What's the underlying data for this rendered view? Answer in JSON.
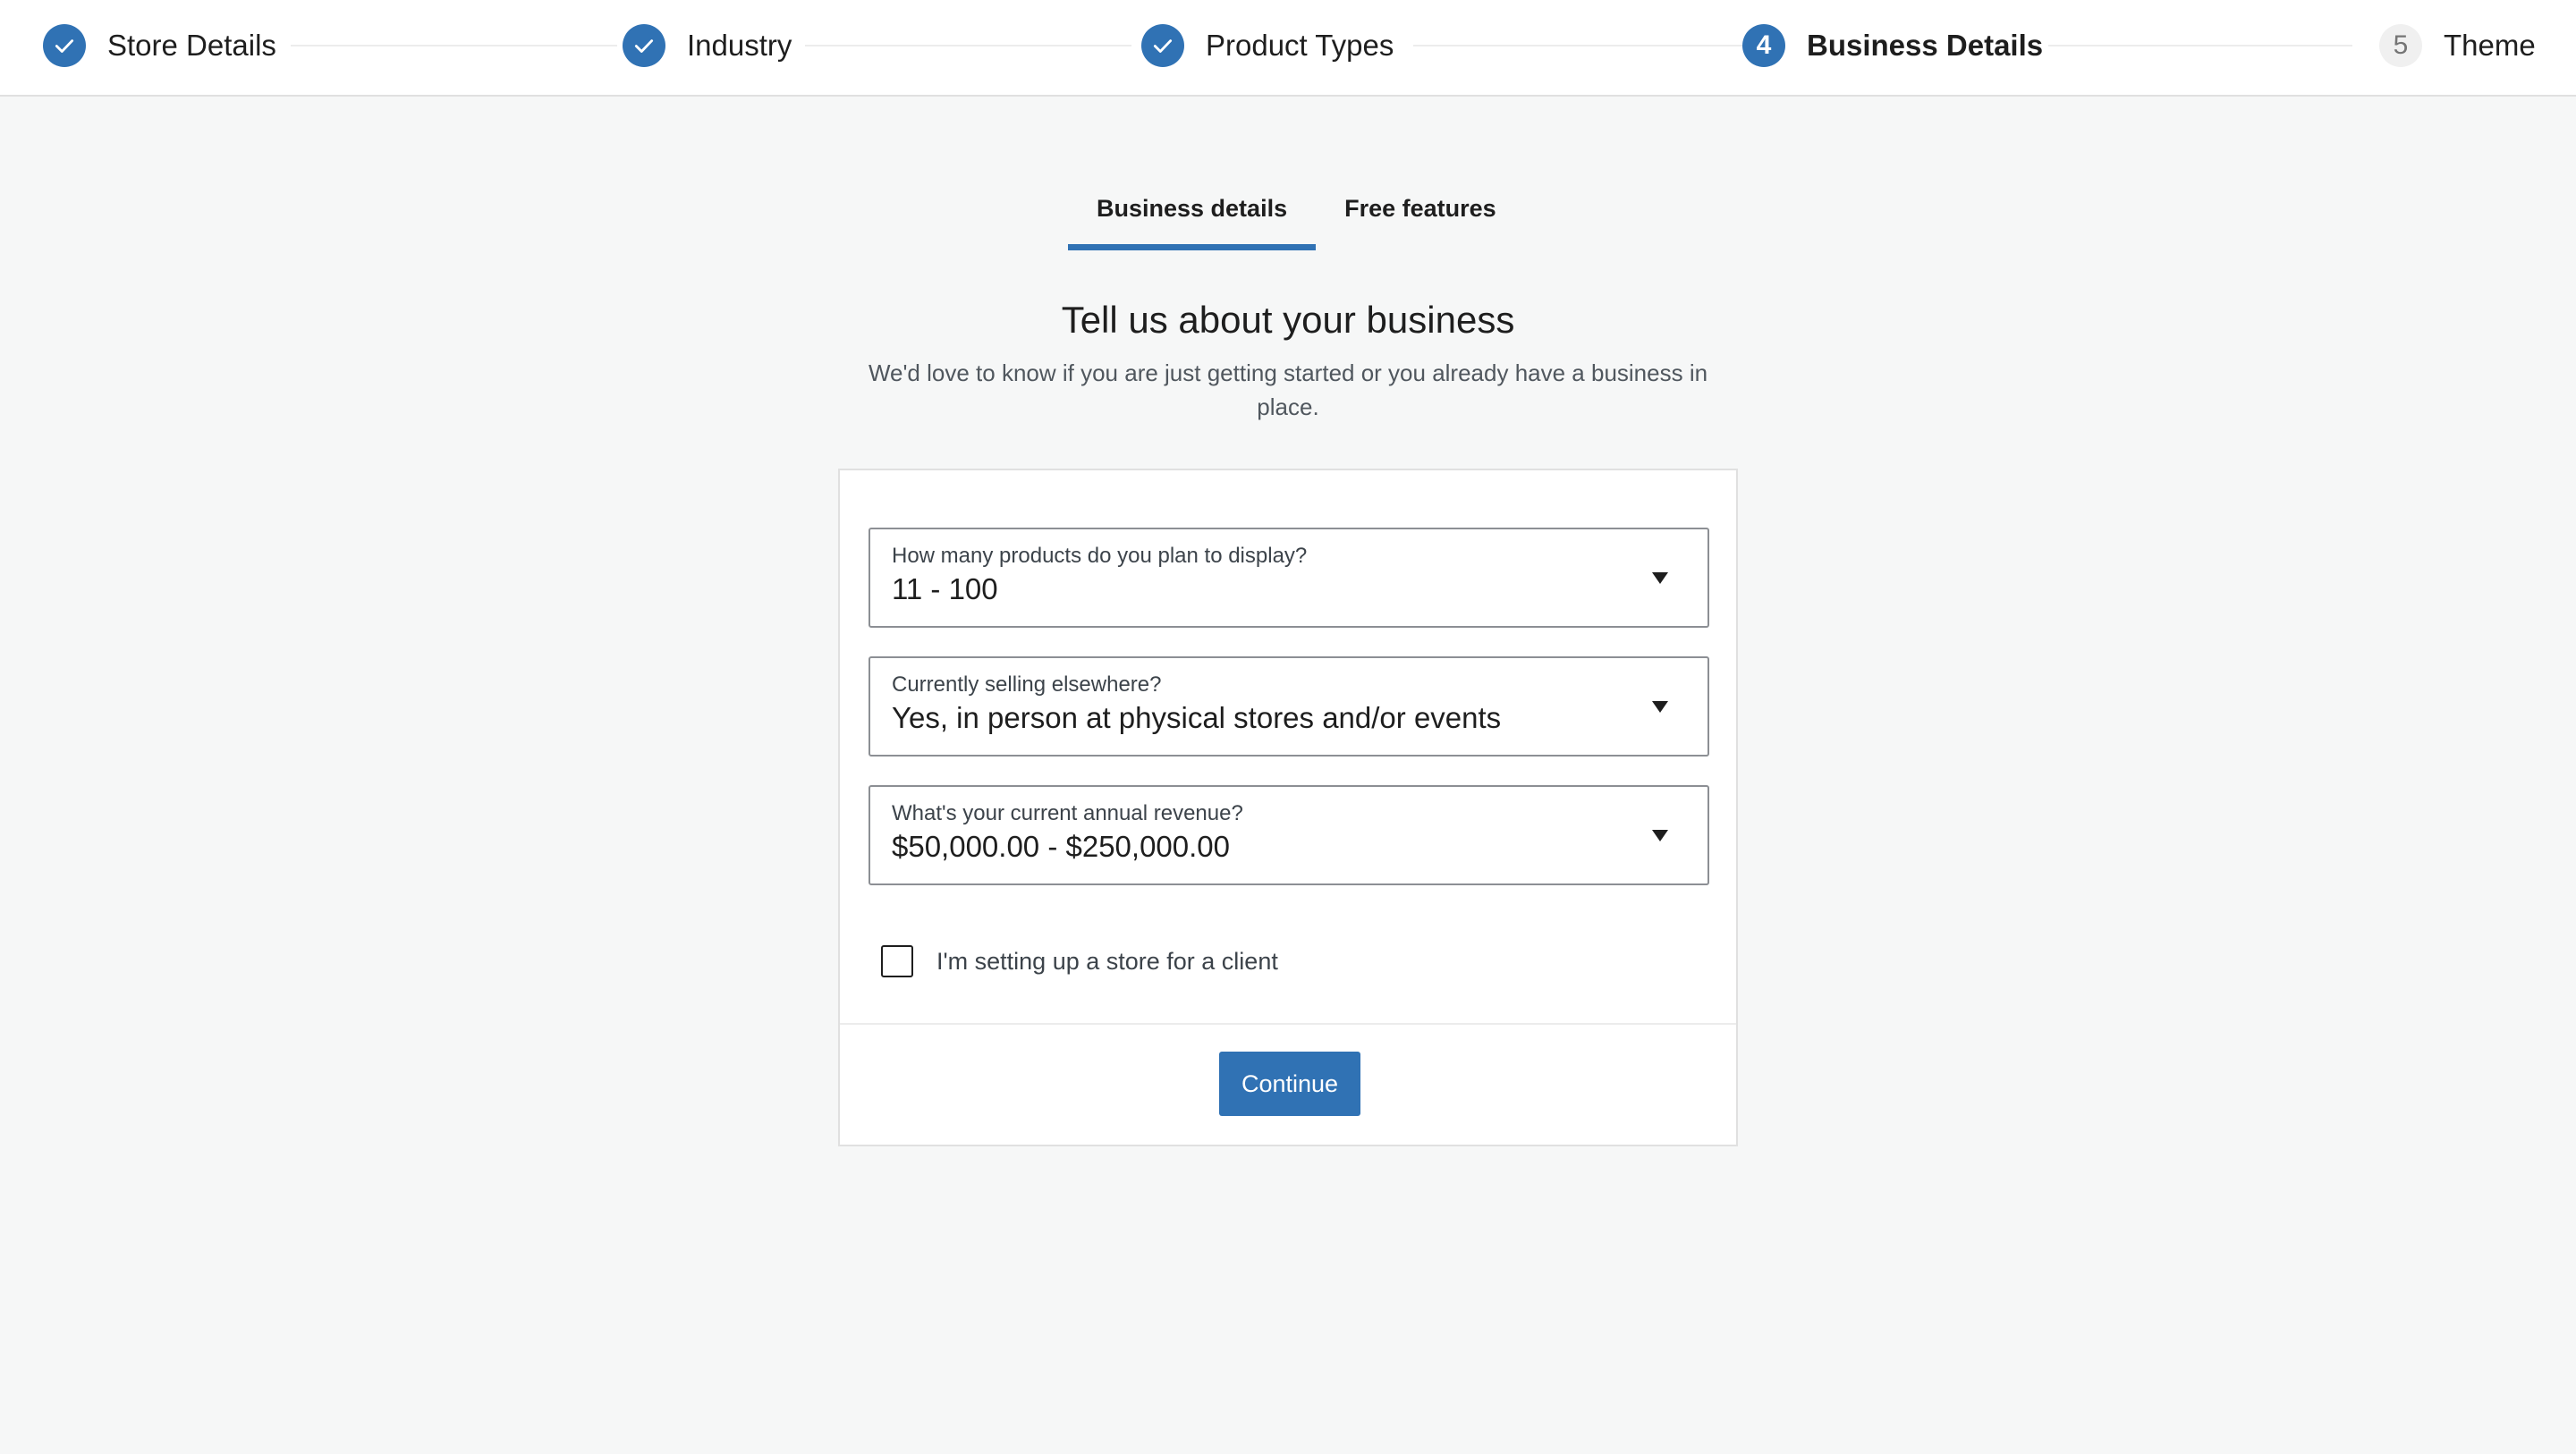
{
  "colors": {
    "accent": "#3072b4",
    "page_background": "#f6f7f7",
    "card_background": "#ffffff"
  },
  "stepper": {
    "steps": [
      {
        "label": "Store Details",
        "status": "complete",
        "icon": "checkmark-icon"
      },
      {
        "label": "Industry",
        "status": "complete",
        "icon": "checkmark-icon"
      },
      {
        "label": "Product Types",
        "status": "complete",
        "icon": "checkmark-icon"
      },
      {
        "label": "Business Details",
        "status": "current",
        "number": "4"
      },
      {
        "label": "Theme",
        "status": "upcoming",
        "number": "5"
      }
    ]
  },
  "tabs": [
    {
      "label": "Business details",
      "active": true
    },
    {
      "label": "Free features",
      "active": false
    }
  ],
  "heading": {
    "title": "Tell us about your business",
    "subtitle": "We'd love to know if you are just getting started or you already have a business in place."
  },
  "form": {
    "fields": [
      {
        "label": "How many products do you plan to display?",
        "value": "11 - 100",
        "icon": "dropdown-arrow-icon"
      },
      {
        "label": "Currently selling elsewhere?",
        "value": "Yes, in person at physical stores and/or events",
        "icon": "dropdown-arrow-icon"
      },
      {
        "label": "What's your current annual revenue?",
        "value": "$50,000.00 - $250,000.00",
        "icon": "dropdown-arrow-icon"
      }
    ],
    "client_checkbox": {
      "label": "I'm setting up a store for a client",
      "checked": false
    },
    "continue_label": "Continue"
  }
}
